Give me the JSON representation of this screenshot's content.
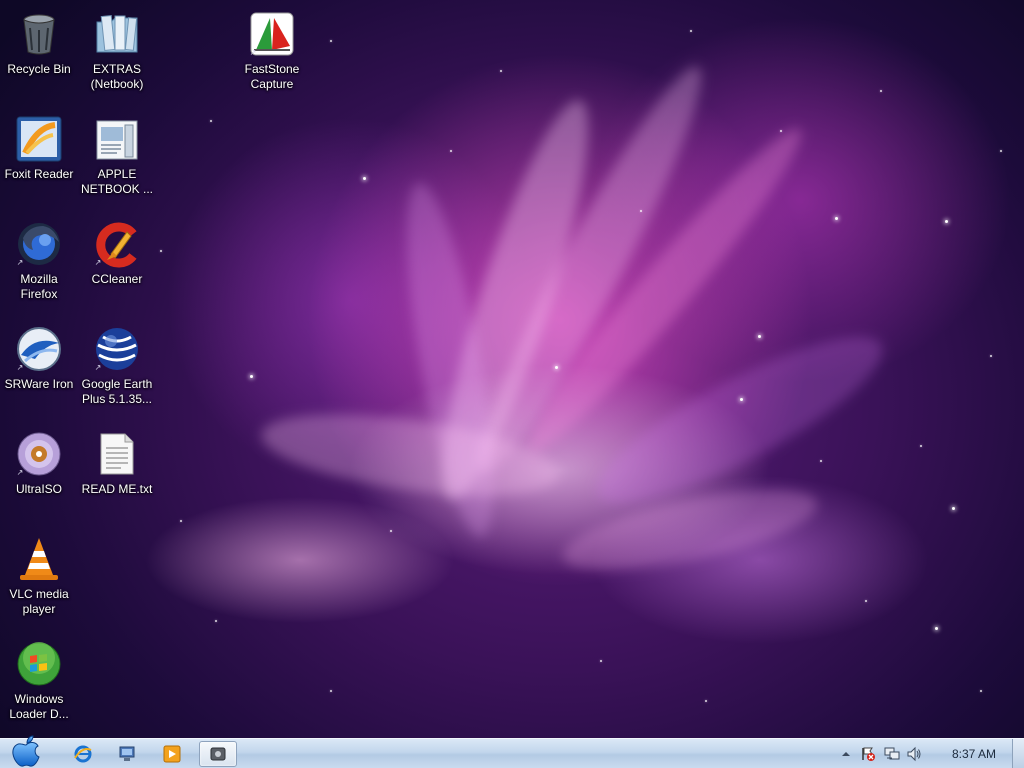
{
  "desktop": {
    "icons": [
      {
        "label": "Recycle Bin",
        "icon": "recycle-bin-icon"
      },
      {
        "label": "EXTRAS (Netbook)",
        "icon": "folder-icon"
      },
      {
        "label": "FastStone Capture",
        "icon": "faststone-capture-icon"
      },
      {
        "label": "Foxit Reader",
        "icon": "foxit-reader-icon"
      },
      {
        "label": "APPLE NETBOOK ...",
        "icon": "document-archive-icon"
      },
      {
        "label": "Mozilla Firefox",
        "icon": "firefox-icon"
      },
      {
        "label": "CCleaner",
        "icon": "ccleaner-icon"
      },
      {
        "label": "SRWare Iron",
        "icon": "srware-iron-icon"
      },
      {
        "label": "Google Earth Plus 5.1.35...",
        "icon": "google-earth-icon"
      },
      {
        "label": "UltraISO",
        "icon": "ultraiso-disc-icon"
      },
      {
        "label": "READ ME.txt",
        "icon": "text-file-icon"
      },
      {
        "label": "VLC media player",
        "icon": "vlc-cone-icon"
      },
      {
        "label": "Windows Loader D...",
        "icon": "windows-orb-icon"
      }
    ]
  },
  "taskbar": {
    "start_icon": "apple-logo-icon",
    "pinned": [
      {
        "icon": "internet-explorer-icon"
      },
      {
        "icon": "network-computer-icon"
      },
      {
        "icon": "media-player-icon"
      },
      {
        "icon": "screen-capture-icon",
        "active": true
      }
    ],
    "tray": {
      "icons": [
        "show-hidden-icons-arrow",
        "action-center-flag-icon",
        "network-icon",
        "volume-icon"
      ],
      "clock": "8:37 AM"
    }
  },
  "colors": {
    "taskbar_top": "#dbe8f6",
    "taskbar_bottom": "#c9dbef",
    "label_text": "#ffffff"
  }
}
